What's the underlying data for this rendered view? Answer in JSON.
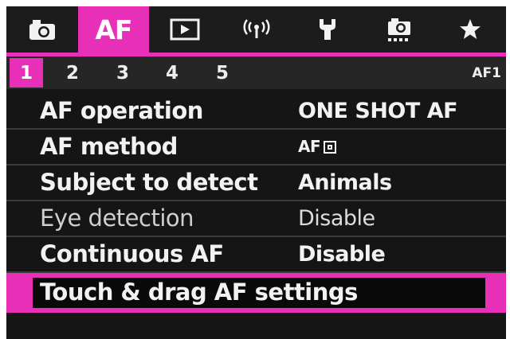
{
  "tabs": [
    {
      "name": "camera-tab",
      "icon": "camera-icon",
      "label": ""
    },
    {
      "name": "af-tab",
      "icon": "",
      "label": "AF"
    },
    {
      "name": "playback-tab",
      "icon": "playback-icon",
      "label": ""
    },
    {
      "name": "wireless-tab",
      "icon": "wireless-icon",
      "label": ""
    },
    {
      "name": "setup-tab",
      "icon": "wrench-icon",
      "label": ""
    },
    {
      "name": "custom-functions-tab",
      "icon": "custom-camera-icon",
      "label": ""
    },
    {
      "name": "my-menu-tab",
      "icon": "star-icon",
      "label": ""
    }
  ],
  "active_tab": "AF",
  "pages": [
    "1",
    "2",
    "3",
    "4",
    "5"
  ],
  "active_page": "1",
  "page_id": "AF1",
  "menu": {
    "items": [
      {
        "label": "AF operation",
        "value": "ONE SHOT AF",
        "enabled": true
      },
      {
        "label": "AF method",
        "value": "AF",
        "value_icon": "spot-af-icon",
        "enabled": true
      },
      {
        "label": "Subject to detect",
        "value": "Animals",
        "enabled": true
      },
      {
        "label": "Eye detection",
        "value": "Disable",
        "enabled": false
      },
      {
        "label": "Continuous AF",
        "value": "Disable",
        "enabled": true
      },
      {
        "label": "Touch & drag AF settings",
        "value": "",
        "enabled": true,
        "selected": true
      }
    ]
  },
  "colors": {
    "accent": "#e82fb8",
    "background": "#151515",
    "text": "#f2f2f2"
  }
}
